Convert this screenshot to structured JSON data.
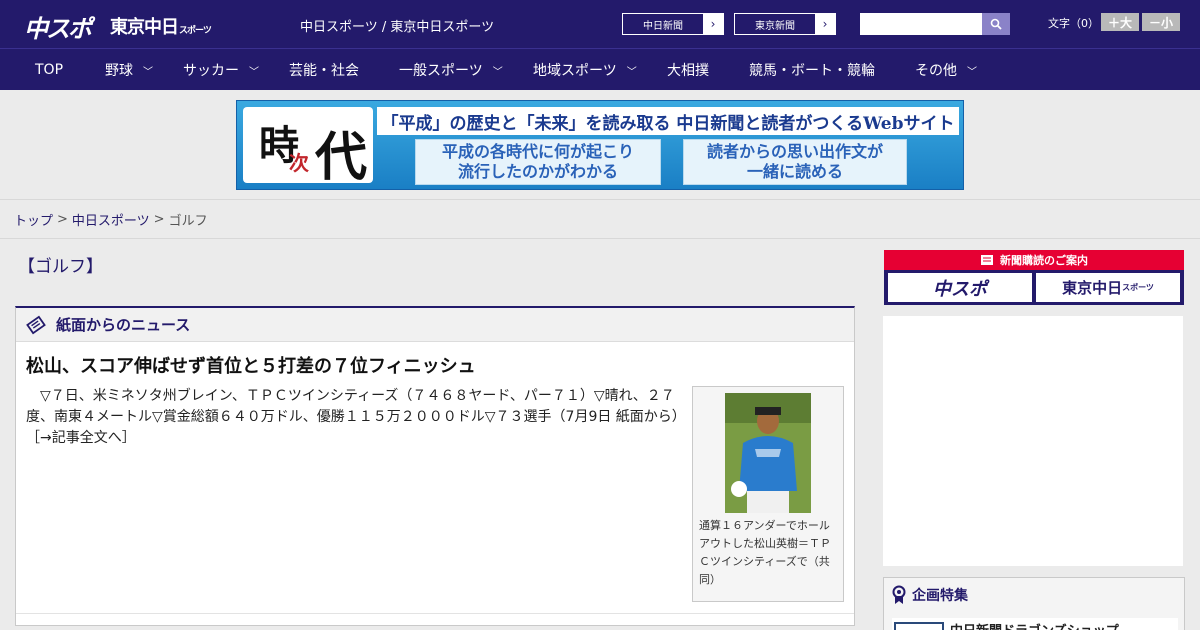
{
  "header": {
    "logo_chuspo": "中スポ",
    "logo_tokyo": "東京中日",
    "logo_tokyo_suffix": "スポーツ",
    "site_title": "中日スポーツ / 東京中日スポーツ",
    "pill_chunichi": "中日新聞",
    "pill_tokyo": "東京新聞",
    "search_placeholder": "",
    "font_size_label": "文字（0）",
    "font_larger": "＋大",
    "font_smaller": "－小"
  },
  "nav": {
    "items": [
      {
        "label": "TOP",
        "has_menu": false
      },
      {
        "label": "野球",
        "has_menu": true
      },
      {
        "label": "サッカー",
        "has_menu": true
      },
      {
        "label": "芸能・社会",
        "has_menu": false
      },
      {
        "label": "一般スポーツ",
        "has_menu": true
      },
      {
        "label": "地域スポーツ",
        "has_menu": true
      },
      {
        "label": "大相撲",
        "has_menu": false
      },
      {
        "label": "競馬・ボート・競輪",
        "has_menu": false
      },
      {
        "label": "その他",
        "has_menu": true
      }
    ]
  },
  "banner": {
    "kanji_ji": "時",
    "kanji_tsugi": "次",
    "kanji_dai": "代",
    "headline": "「平成」の歴史と「未来」を読み取る 中日新聞と読者がつくるWebサイト",
    "box_left": "平成の各時代に何が起こり\n流行したのかがわかる",
    "box_right": "読者からの思い出作文が\n一緒に読める"
  },
  "breadcrumb": {
    "top": "トップ",
    "section": "中日スポーツ",
    "current": "ゴルフ",
    "separator": ">"
  },
  "category_label": "【ゴルフ】",
  "news": {
    "panel_title": "紙面からのニュース",
    "headline": "松山、スコア伸ばせず首位と５打差の７位フィニッシュ",
    "body": "　▽７日、米ミネソタ州ブレイン、ＴＰＣツインシティーズ（７４６８ヤード、パー７１）▽晴れ、２７度、南東４メートル▽賞金総額６４０万ドル、優勝１１５万２０００ドル▽７３選手（7月9日 紙面から）",
    "more_link": "［→記事全文へ］",
    "photo_caption": "通算１６アンダーでホールアウトした松山英樹＝ＴＰＣツインシティーズで（共同）"
  },
  "sidebar": {
    "subscribe_label": "新聞購読のご案内",
    "subscribe_chuspo": "中スポ",
    "subscribe_tokyo": "東京中日",
    "subscribe_tokyo_suffix": "スポーツ",
    "feature_title": "企画特集",
    "feature_item_label": "中日新聞ドラゴンズショップ"
  },
  "colors": {
    "brand_navy": "#231a6b",
    "subscribe_red": "#e60033",
    "search_button": "#8a82c8"
  }
}
